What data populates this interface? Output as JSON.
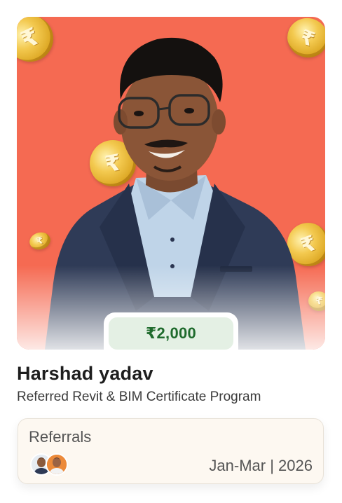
{
  "reward": {
    "amount": "₹2,000"
  },
  "person": {
    "name": "Harshad yadav",
    "program_text": "Referred Revit & BIM Certificate Program"
  },
  "referrals": {
    "label": "Referrals",
    "period": "Jan-Mar | 2026",
    "avatars": [
      "avatar-1",
      "avatar-2"
    ]
  },
  "decor": {
    "coin_symbol": "₹",
    "background_color": "#f56a52",
    "amount_color": "#1f6b2d"
  }
}
